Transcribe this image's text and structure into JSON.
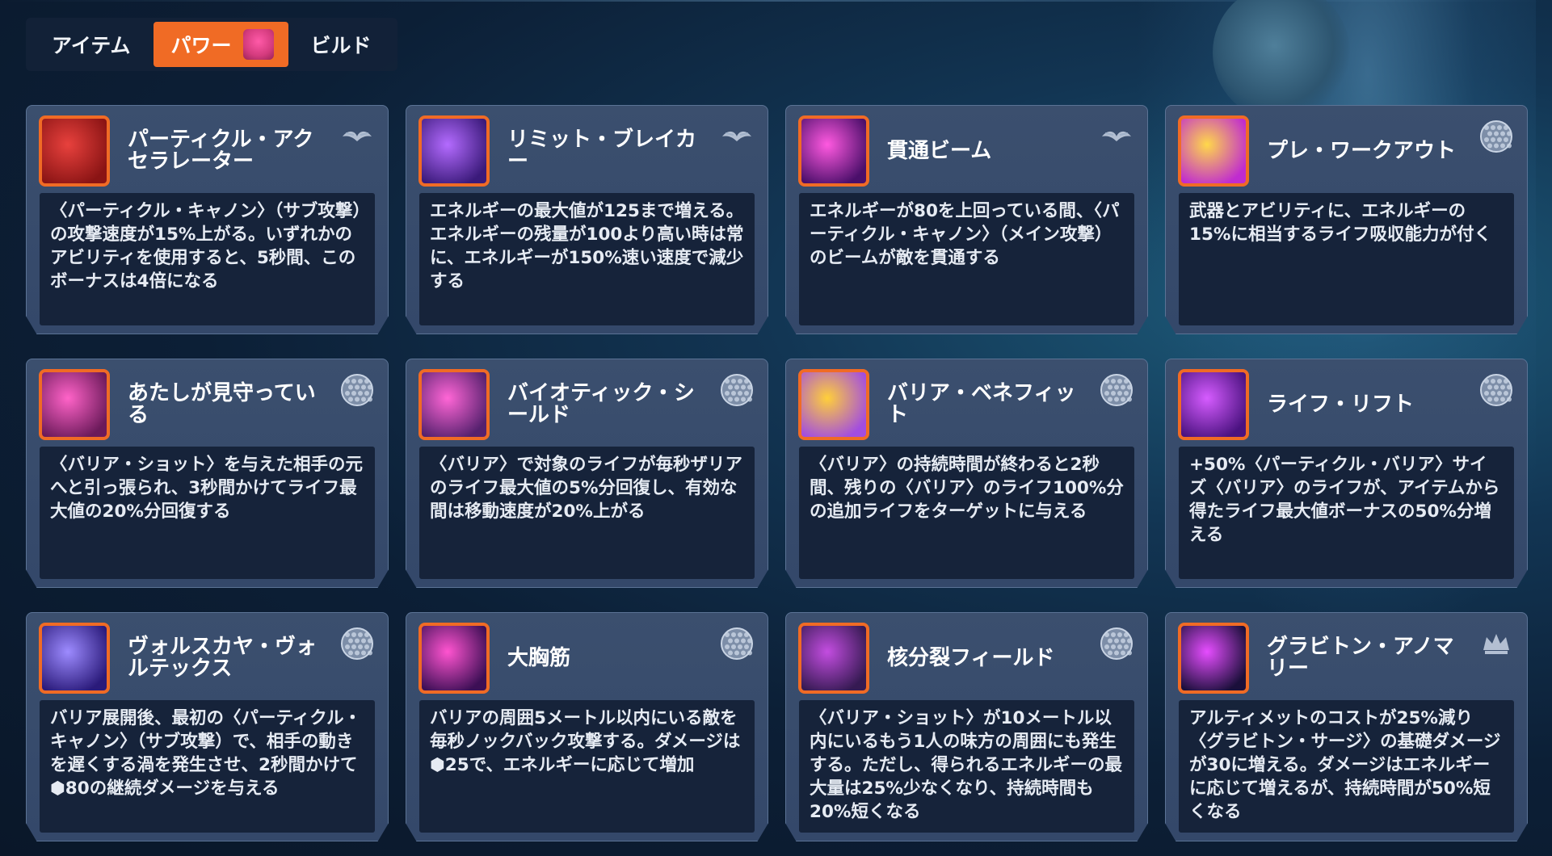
{
  "tabs": [
    {
      "label": "アイテム",
      "active": false
    },
    {
      "label": "パワー",
      "active": true
    },
    {
      "label": "ビルド",
      "active": false
    }
  ],
  "colors": {
    "accent": "#f06b25",
    "card_bg": "#3b4f6e",
    "desc_bg": "#16233a"
  },
  "cards": [
    {
      "title": "パーティクル・アクセラレーター",
      "rarity_icon": "wings-icon",
      "desc": "〈パーティクル・キャノン〉（サブ攻撃）の攻撃速度が15%上がる。いずれかのアビリティを使用すると、5秒間、このボーナスは4倍になる",
      "icon_colors": [
        "#e8413d",
        "#8a1414"
      ]
    },
    {
      "title": "リミット・ブレイカー",
      "rarity_icon": "wings-icon",
      "desc": "エネルギーの最大値が125まで増える。エネルギーの残量が100より高い時は常に、エネルギーが150%速い速度で減少する",
      "icon_colors": [
        "#b46bff",
        "#3a1a7a"
      ]
    },
    {
      "title": "貫通ビーム",
      "rarity_icon": "wings-icon",
      "desc": "エネルギーが80を上回っている間、〈パーティクル・キャノン〉（メイン攻撃）のビームが敵を貫通する",
      "icon_colors": [
        "#ff59e0",
        "#4a0f6a"
      ]
    },
    {
      "title": "プレ・ワークアウト",
      "rarity_icon": "hexagon-icon",
      "desc": "武器とアビリティに、エネルギーの15%に相当するライフ吸収能力が付く",
      "icon_colors": [
        "#ffd84a",
        "#c02bd0"
      ]
    },
    {
      "title": "あたしが見守っている",
      "rarity_icon": "hexagon-icon",
      "desc": "〈バリア・ショット〉を与えた相手の元へと引っ張られ、3秒間かけてライフ最大値の20%分回復する",
      "icon_colors": [
        "#ff63c8",
        "#6b1a5a"
      ]
    },
    {
      "title": "バイオティック・シールド",
      "rarity_icon": "hexagon-icon",
      "desc": "〈バリア〉で対象のライフが毎秒ザリアのライフ最大値の5%分回復し、有効な間は移動速度が20%上がる",
      "icon_colors": [
        "#ff66d6",
        "#55216e"
      ]
    },
    {
      "title": "バリア・ベネフィット",
      "rarity_icon": "hexagon-icon",
      "desc": "〈バリア〉の持続時間が終わると2秒間、残りの〈バリア〉のライフ100%分の追加ライフをターゲットに与える",
      "icon_colors": [
        "#ffcf3a",
        "#a24de0"
      ]
    },
    {
      "title": "ライフ・リフト",
      "rarity_icon": "hexagon-icon",
      "desc": "+50%〈パーティクル・バリア〉サイズ〈バリア〉のライフが、アイテムから得たライフ最大値ボーナスの50%分増える",
      "icon_colors": [
        "#d65cff",
        "#4a1280"
      ]
    },
    {
      "title": "ヴォルスカヤ・ヴォルテックス",
      "rarity_icon": "hexagon-icon",
      "desc": "バリア展開後、最初の〈パーティクル・キャノン〉（サブ攻撃）で、相手の動きを遅くする渦を発生させ、2秒間かけて⬢80の継続ダメージを与える",
      "icon_colors": [
        "#9d8bff",
        "#2a1a7a"
      ]
    },
    {
      "title": "大胸筋",
      "rarity_icon": "hexagon-icon",
      "desc": "バリアの周囲5メートル以内にいる敵を毎秒ノックバック攻撃する。ダメージは⬢25で、エネルギーに応じて増加",
      "icon_colors": [
        "#ff54d0",
        "#3c0f55"
      ]
    },
    {
      "title": "核分裂フィールド",
      "rarity_icon": "hexagon-icon",
      "desc": "〈バリア・ショット〉が10メートル以内にいるもう1人の味方の周囲にも発生する。ただし、得られるエネルギーの最大量は25%少なくなり、持続時間も20%短くなる",
      "icon_colors": [
        "#c34de0",
        "#351a52"
      ]
    },
    {
      "title": "グラビトン・アノマリー",
      "rarity_icon": "crown-icon",
      "desc": "アルティメットのコストが25%減り〈グラビトン・サージ〉の基礎ダメージが30に増える。ダメージはエネルギーに応じて増えるが、持続時間が50%短くなる",
      "icon_colors": [
        "#e64dff",
        "#1a0f3a"
      ]
    }
  ]
}
